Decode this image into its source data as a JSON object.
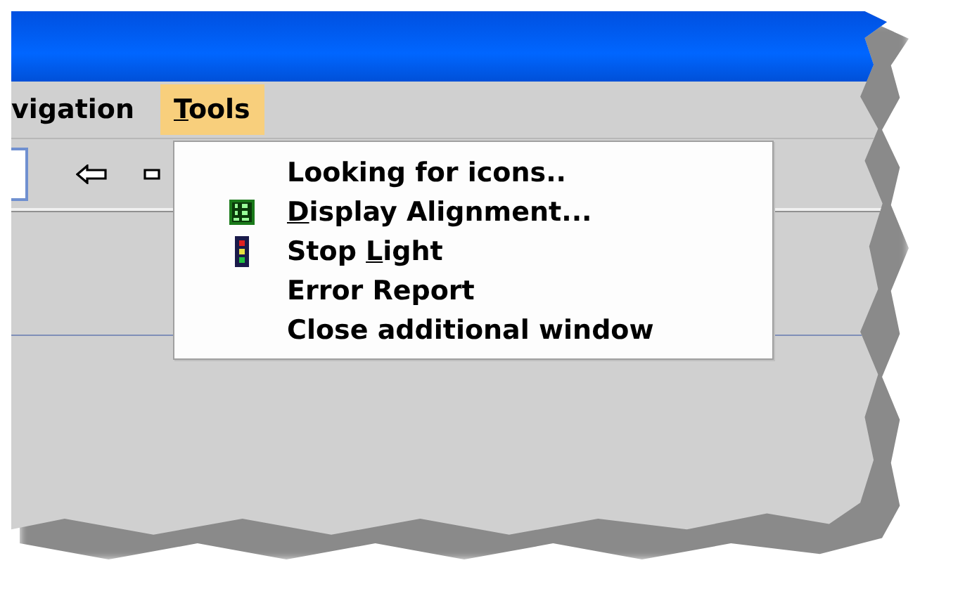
{
  "menu_bar": [
    {
      "label_parts": {
        "text": "vigation"
      },
      "selected": false
    },
    {
      "label_parts": {
        "key": "T",
        "after": "ools"
      },
      "selected": true
    }
  ],
  "toolbar": {
    "kind": "navigation"
  },
  "dropdown": {
    "items": [
      {
        "kind": "plain",
        "label_parts": {
          "text": "Looking for icons.."
        }
      },
      {
        "kind": "display",
        "label_parts": {
          "key": "D",
          "after": "isplay Alignment..."
        }
      },
      {
        "kind": "stoplight",
        "label_parts": {
          "before": "Stop ",
          "key": "L",
          "after": "ight"
        }
      },
      {
        "kind": "plain",
        "label_parts": {
          "text": "Error Report"
        }
      },
      {
        "kind": "plain",
        "label_parts": {
          "text": "Close additional window"
        }
      }
    ]
  }
}
